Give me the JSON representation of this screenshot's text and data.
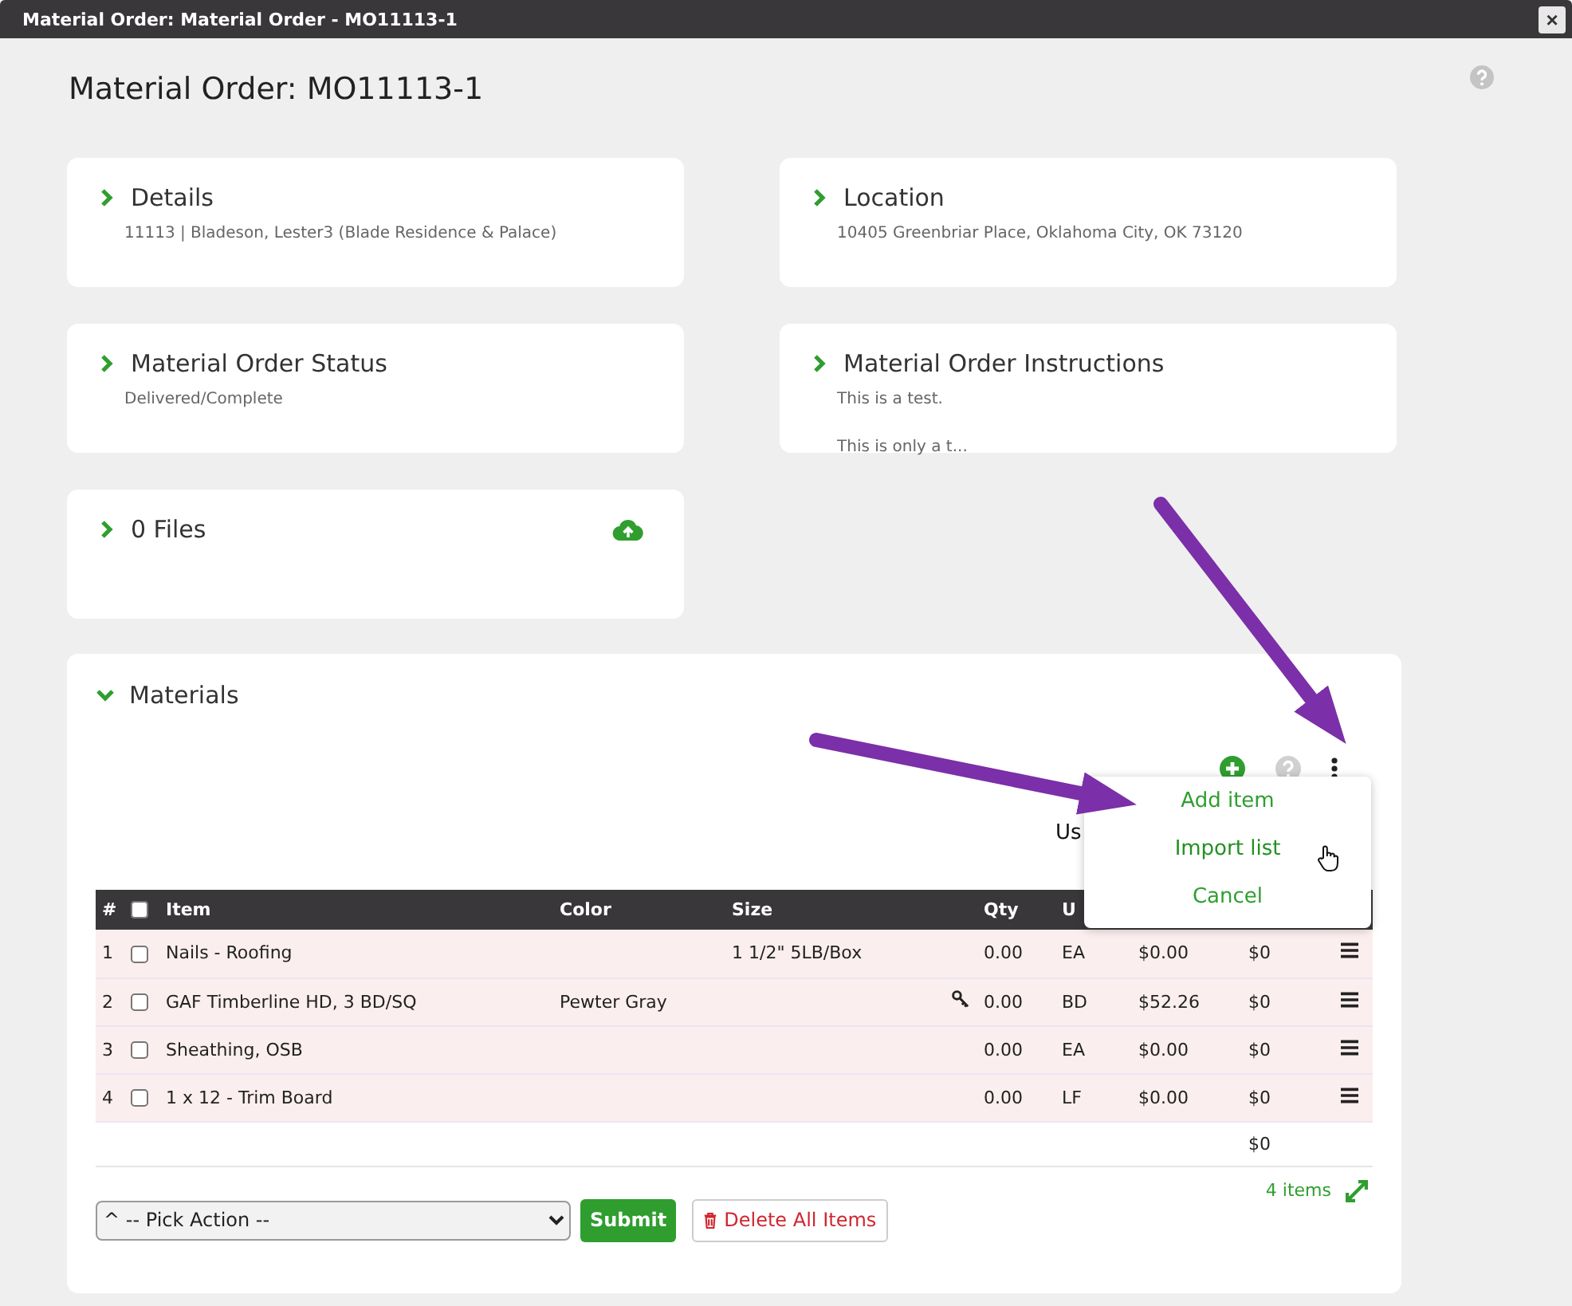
{
  "window": {
    "title": "Material Order: Material Order - MO11113-1",
    "close": "×"
  },
  "page_title": "Material Order: MO11113-1",
  "cards": [
    {
      "title": "Details",
      "expanded": false,
      "lines": [
        "11113 | Bladeson, Lester3 (Blade Residence & Palace)"
      ]
    },
    {
      "title": "Location",
      "expanded": false,
      "lines": [
        "10405 Greenbriar Place, Oklahoma City, OK 73120"
      ]
    },
    {
      "title": "Material Order Status",
      "expanded": false,
      "lines": [
        "Delivered/Complete"
      ]
    },
    {
      "title": "Material Order Instructions",
      "expanded": false,
      "lines": [
        "This is a test.",
        "This is only a t..."
      ]
    },
    {
      "title": "0 Files",
      "expanded": false,
      "upload": true
    }
  ],
  "materials": {
    "title": "Materials",
    "expanded": true,
    "partial_text": "Us",
    "menu": [
      {
        "label": "Add item",
        "hovered": false
      },
      {
        "label": "Import list",
        "hovered": true
      },
      {
        "label": "Cancel",
        "hovered": false
      }
    ],
    "columns": [
      "#",
      "Item",
      "Color",
      "Size",
      "Qty",
      "U"
    ],
    "header_checked": false,
    "rows": [
      {
        "num": "1",
        "checked": false,
        "item": "Nails - Roofing",
        "finish": "",
        "size": "1 1/2\" 5LB/Box",
        "has_options": false,
        "qty": "0.00",
        "unit": "EA",
        "price": "$0.00",
        "total": "$0"
      },
      {
        "num": "2",
        "checked": false,
        "item": "GAF Timberline HD, 3 BD/SQ",
        "finish": "Pewter Gray",
        "size": "",
        "has_options": true,
        "qty": "0.00",
        "unit": "BD",
        "price": "$52.26",
        "total": "$0"
      },
      {
        "num": "3",
        "checked": false,
        "item": "Sheathing, OSB",
        "finish": "",
        "size": "",
        "has_options": false,
        "qty": "0.00",
        "unit": "EA",
        "price": "$0.00",
        "total": "$0"
      },
      {
        "num": "4",
        "checked": false,
        "item": "1 x 12 - Trim Board",
        "finish": "",
        "size": "",
        "has_options": false,
        "qty": "0.00",
        "unit": "LF",
        "price": "$0.00",
        "total": "$0"
      }
    ],
    "grand_total": "$0",
    "action_select": "^ -- Pick Action --",
    "submit": "Submit",
    "delete_all": "Delete All Items",
    "item_count": "4 items"
  }
}
